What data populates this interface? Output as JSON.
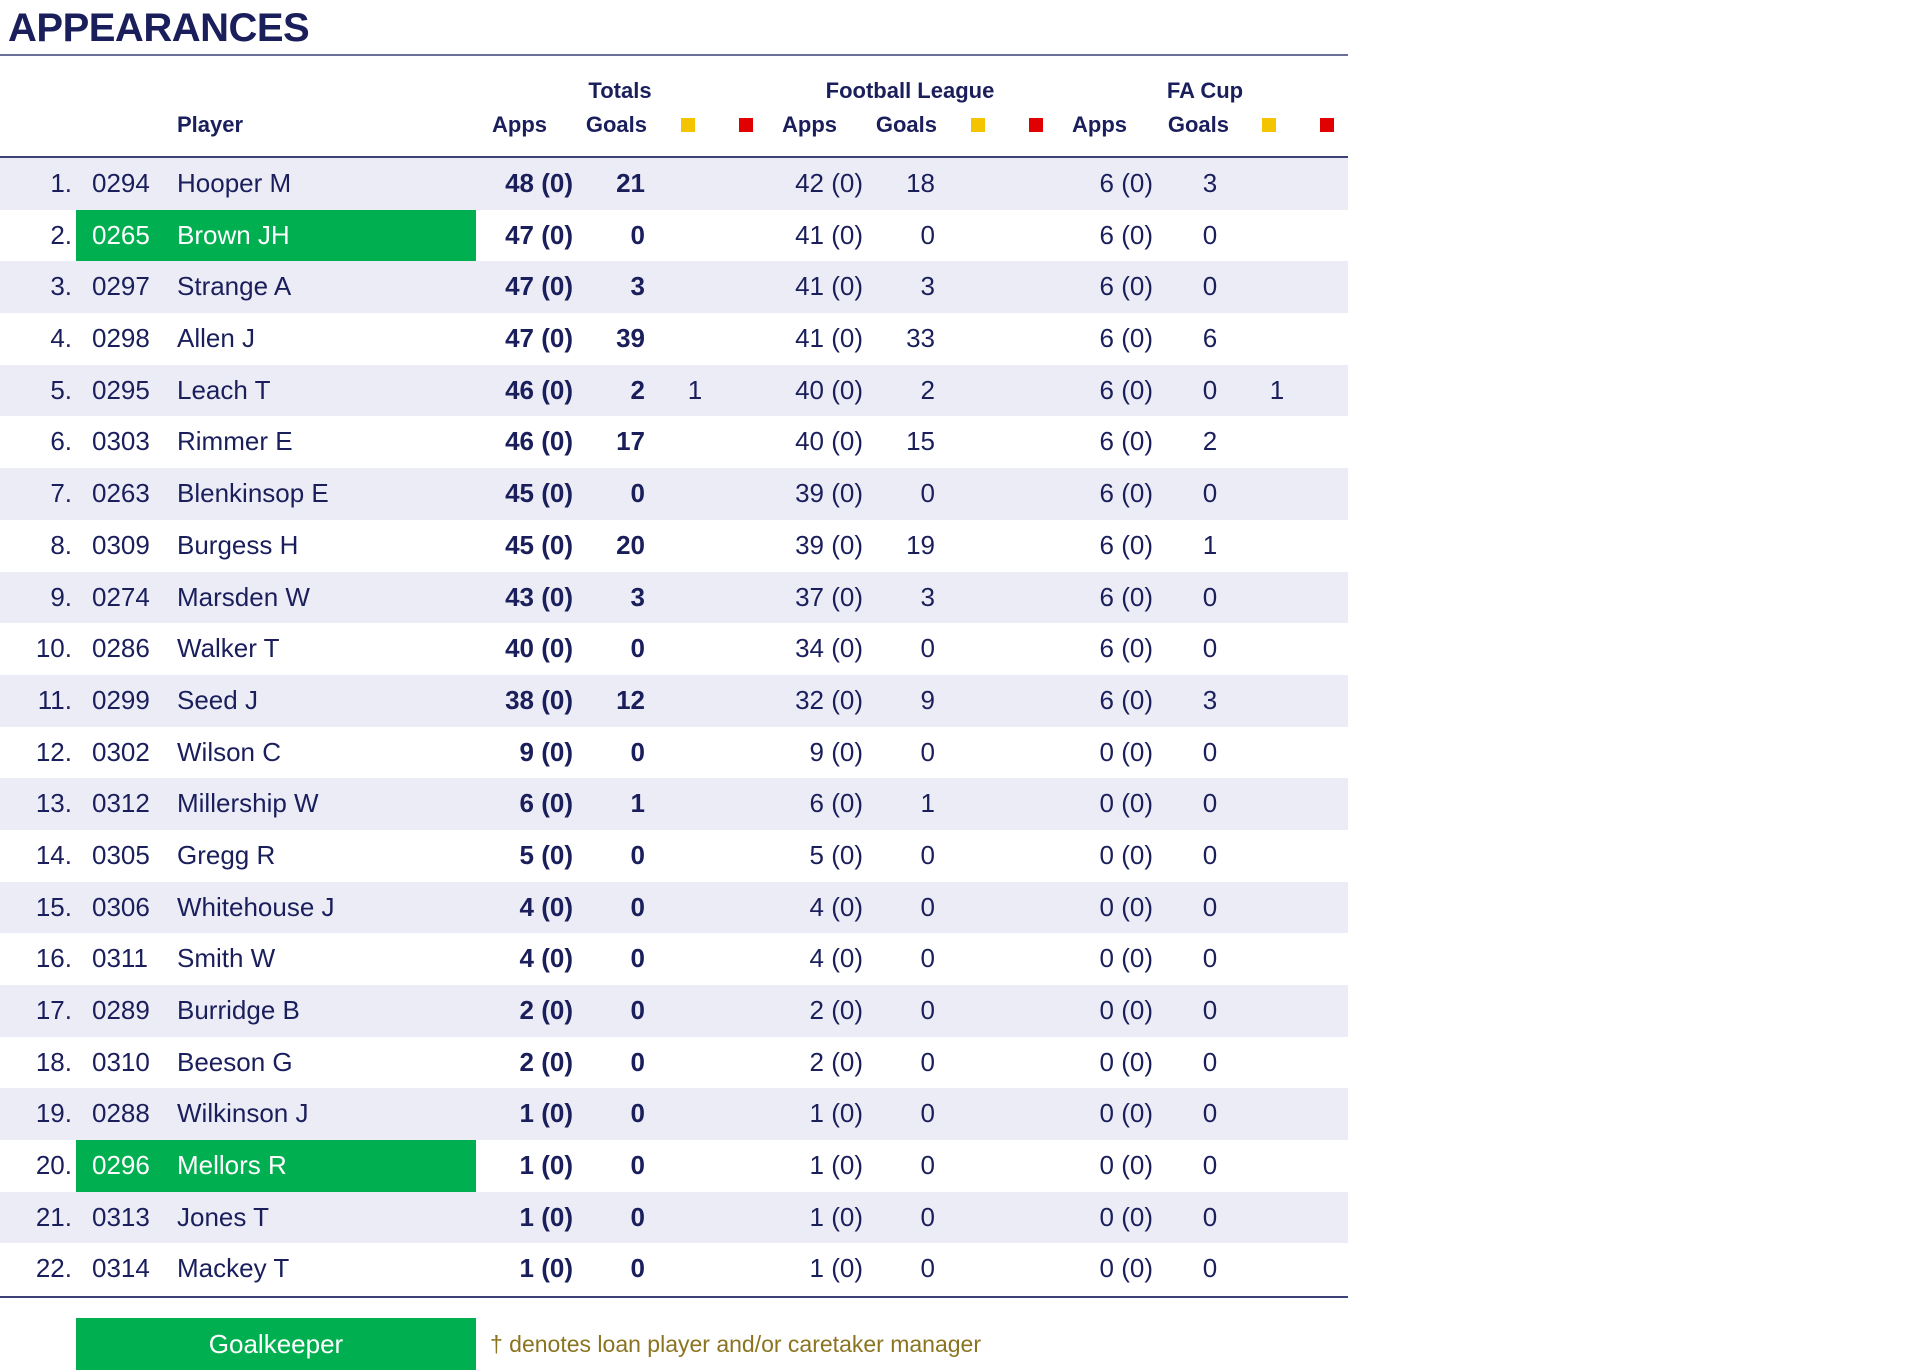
{
  "title": "APPEARANCES",
  "headers": {
    "groups": {
      "totals": "Totals",
      "league": "Football League",
      "cup": "FA Cup"
    },
    "player": "Player",
    "apps": "Apps",
    "goals": "Goals"
  },
  "colors": {
    "goalkeeper": "#00b050",
    "yellow_card": "#f5c400",
    "red_card": "#e00000",
    "text": "#1a1f5c"
  },
  "players": [
    {
      "rank": "1.",
      "code": "0294",
      "name": "Hooper M",
      "tapps": "48 (0)",
      "tgoals": "21",
      "ty": "",
      "lapps": "42 (0)",
      "lgoals": "18",
      "capps": "6 (0)",
      "cgoals": "3",
      "cy": "",
      "gk": false
    },
    {
      "rank": "2.",
      "code": "0265",
      "name": "Brown JH",
      "tapps": "47 (0)",
      "tgoals": "0",
      "ty": "",
      "lapps": "41 (0)",
      "lgoals": "0",
      "capps": "6 (0)",
      "cgoals": "0",
      "cy": "",
      "gk": true
    },
    {
      "rank": "3.",
      "code": "0297",
      "name": "Strange A",
      "tapps": "47 (0)",
      "tgoals": "3",
      "ty": "",
      "lapps": "41 (0)",
      "lgoals": "3",
      "capps": "6 (0)",
      "cgoals": "0",
      "cy": "",
      "gk": false
    },
    {
      "rank": "4.",
      "code": "0298",
      "name": "Allen J",
      "tapps": "47 (0)",
      "tgoals": "39",
      "ty": "",
      "lapps": "41 (0)",
      "lgoals": "33",
      "capps": "6 (0)",
      "cgoals": "6",
      "cy": "",
      "gk": false
    },
    {
      "rank": "5.",
      "code": "0295",
      "name": "Leach T",
      "tapps": "46 (0)",
      "tgoals": "2",
      "ty": "1",
      "lapps": "40 (0)",
      "lgoals": "2",
      "capps": "6 (0)",
      "cgoals": "0",
      "cy": "1",
      "gk": false
    },
    {
      "rank": "6.",
      "code": "0303",
      "name": "Rimmer E",
      "tapps": "46 (0)",
      "tgoals": "17",
      "ty": "",
      "lapps": "40 (0)",
      "lgoals": "15",
      "capps": "6 (0)",
      "cgoals": "2",
      "cy": "",
      "gk": false
    },
    {
      "rank": "7.",
      "code": "0263",
      "name": "Blenkinsop E",
      "tapps": "45 (0)",
      "tgoals": "0",
      "ty": "",
      "lapps": "39 (0)",
      "lgoals": "0",
      "capps": "6 (0)",
      "cgoals": "0",
      "cy": "",
      "gk": false
    },
    {
      "rank": "8.",
      "code": "0309",
      "name": "Burgess H",
      "tapps": "45 (0)",
      "tgoals": "20",
      "ty": "",
      "lapps": "39 (0)",
      "lgoals": "19",
      "capps": "6 (0)",
      "cgoals": "1",
      "cy": "",
      "gk": false
    },
    {
      "rank": "9.",
      "code": "0274",
      "name": "Marsden W",
      "tapps": "43 (0)",
      "tgoals": "3",
      "ty": "",
      "lapps": "37 (0)",
      "lgoals": "3",
      "capps": "6 (0)",
      "cgoals": "0",
      "cy": "",
      "gk": false
    },
    {
      "rank": "10.",
      "code": "0286",
      "name": "Walker T",
      "tapps": "40 (0)",
      "tgoals": "0",
      "ty": "",
      "lapps": "34 (0)",
      "lgoals": "0",
      "capps": "6 (0)",
      "cgoals": "0",
      "cy": "",
      "gk": false
    },
    {
      "rank": "11.",
      "code": "0299",
      "name": "Seed J",
      "tapps": "38 (0)",
      "tgoals": "12",
      "ty": "",
      "lapps": "32 (0)",
      "lgoals": "9",
      "capps": "6 (0)",
      "cgoals": "3",
      "cy": "",
      "gk": false
    },
    {
      "rank": "12.",
      "code": "0302",
      "name": "Wilson C",
      "tapps": "9 (0)",
      "tgoals": "0",
      "ty": "",
      "lapps": "9 (0)",
      "lgoals": "0",
      "capps": "0 (0)",
      "cgoals": "0",
      "cy": "",
      "gk": false
    },
    {
      "rank": "13.",
      "code": "0312",
      "name": "Millership W",
      "tapps": "6 (0)",
      "tgoals": "1",
      "ty": "",
      "lapps": "6 (0)",
      "lgoals": "1",
      "capps": "0 (0)",
      "cgoals": "0",
      "cy": "",
      "gk": false
    },
    {
      "rank": "14.",
      "code": "0305",
      "name": "Gregg R",
      "tapps": "5 (0)",
      "tgoals": "0",
      "ty": "",
      "lapps": "5 (0)",
      "lgoals": "0",
      "capps": "0 (0)",
      "cgoals": "0",
      "cy": "",
      "gk": false
    },
    {
      "rank": "15.",
      "code": "0306",
      "name": "Whitehouse J",
      "tapps": "4 (0)",
      "tgoals": "0",
      "ty": "",
      "lapps": "4 (0)",
      "lgoals": "0",
      "capps": "0 (0)",
      "cgoals": "0",
      "cy": "",
      "gk": false
    },
    {
      "rank": "16.",
      "code": "0311",
      "name": "Smith W",
      "tapps": "4 (0)",
      "tgoals": "0",
      "ty": "",
      "lapps": "4 (0)",
      "lgoals": "0",
      "capps": "0 (0)",
      "cgoals": "0",
      "cy": "",
      "gk": false
    },
    {
      "rank": "17.",
      "code": "0289",
      "name": "Burridge B",
      "tapps": "2 (0)",
      "tgoals": "0",
      "ty": "",
      "lapps": "2 (0)",
      "lgoals": "0",
      "capps": "0 (0)",
      "cgoals": "0",
      "cy": "",
      "gk": false
    },
    {
      "rank": "18.",
      "code": "0310",
      "name": "Beeson G",
      "tapps": "2 (0)",
      "tgoals": "0",
      "ty": "",
      "lapps": "2 (0)",
      "lgoals": "0",
      "capps": "0 (0)",
      "cgoals": "0",
      "cy": "",
      "gk": false
    },
    {
      "rank": "19.",
      "code": "0288",
      "name": "Wilkinson J",
      "tapps": "1 (0)",
      "tgoals": "0",
      "ty": "",
      "lapps": "1 (0)",
      "lgoals": "0",
      "capps": "0 (0)",
      "cgoals": "0",
      "cy": "",
      "gk": false
    },
    {
      "rank": "20.",
      "code": "0296",
      "name": "Mellors R",
      "tapps": "1 (0)",
      "tgoals": "0",
      "ty": "",
      "lapps": "1 (0)",
      "lgoals": "0",
      "capps": "0 (0)",
      "cgoals": "0",
      "cy": "",
      "gk": true
    },
    {
      "rank": "21.",
      "code": "0313",
      "name": "Jones T",
      "tapps": "1 (0)",
      "tgoals": "0",
      "ty": "",
      "lapps": "1 (0)",
      "lgoals": "0",
      "capps": "0 (0)",
      "cgoals": "0",
      "cy": "",
      "gk": false
    },
    {
      "rank": "22.",
      "code": "0314",
      "name": "Mackey T",
      "tapps": "1 (0)",
      "tgoals": "0",
      "ty": "",
      "lapps": "1 (0)",
      "lgoals": "0",
      "capps": "0 (0)",
      "cgoals": "0",
      "cy": "",
      "gk": false
    }
  ],
  "legend": {
    "goalkeeper": "Goalkeeper",
    "note": "† denotes loan player and/or caretaker manager"
  }
}
